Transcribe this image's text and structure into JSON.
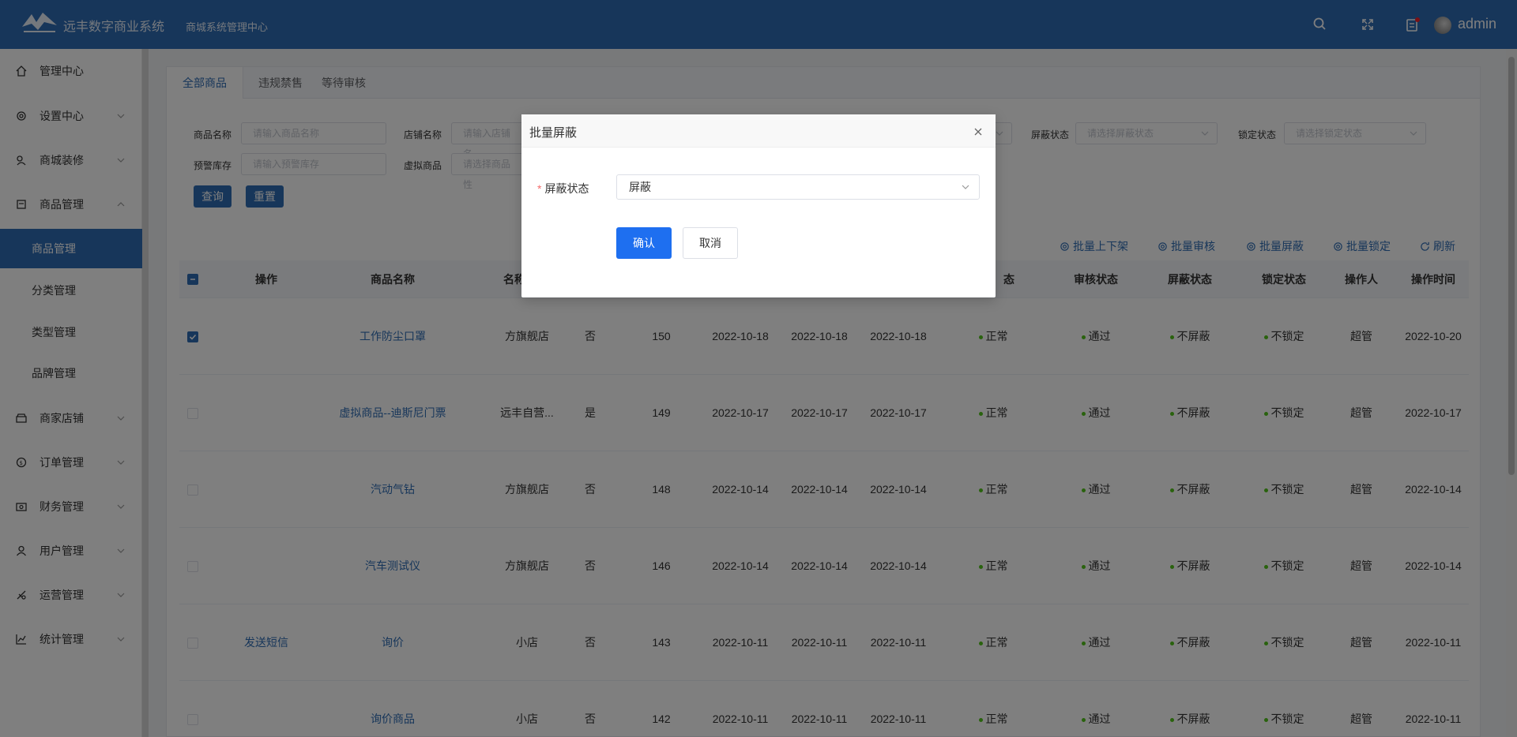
{
  "header": {
    "app_title": "远丰数字商业系统",
    "sub_title": "商城系统管理中心",
    "user": "admin"
  },
  "sidebar": {
    "items": [
      {
        "label": "管理中心",
        "icon": "home-icon"
      },
      {
        "label": "设置中心",
        "icon": "gear-icon"
      },
      {
        "label": "商城装修",
        "icon": "decoration-icon"
      },
      {
        "label": "商品管理",
        "icon": "goods-icon"
      },
      {
        "label": "商家店铺",
        "icon": "shop-icon"
      },
      {
        "label": "订单管理",
        "icon": "order-icon"
      },
      {
        "label": "财务管理",
        "icon": "finance-icon"
      },
      {
        "label": "用户管理",
        "icon": "user-icon"
      },
      {
        "label": "运营管理",
        "icon": "operation-icon"
      },
      {
        "label": "统计管理",
        "icon": "chart-icon"
      }
    ],
    "sub_items": [
      "商品管理",
      "分类管理",
      "类型管理",
      "品牌管理"
    ]
  },
  "tabs": [
    "全部商品",
    "违规禁售",
    "等待审核"
  ],
  "filters": {
    "goods_name": {
      "label": "商品名称",
      "placeholder": "请输入商品名称"
    },
    "store_name": {
      "label": "店铺名称",
      "placeholder": "请输入店铺名"
    },
    "shield_status": {
      "label": "屏蔽状态",
      "placeholder": "请选择屏蔽状态"
    },
    "lock_status": {
      "label": "锁定状态",
      "placeholder": "请选择锁定状态"
    },
    "warning_stock": {
      "label": "预警库存",
      "placeholder": "请输入预警库存"
    },
    "virtual_goods": {
      "label": "虚拟商品",
      "placeholder": "请选择商品性"
    },
    "query_label": "查询",
    "reset_label": "重置"
  },
  "toolbar": {
    "batch_shelf": "批量上下架",
    "batch_audit": "批量审核",
    "batch_shield": "批量屏蔽",
    "batch_lock": "批量锁定",
    "refresh": "刷新"
  },
  "table": {
    "headers": {
      "op": "操作",
      "goods_name": "商品名称",
      "store_name": "名称",
      "status": "态",
      "audit": "审核状态",
      "shield": "屏蔽状态",
      "lock": "锁定状态",
      "operator": "操作人",
      "op_time": "操作时间"
    },
    "rows": [
      {
        "checked": true,
        "op": "",
        "name": "工作防尘口罩",
        "store": "方旗舰店",
        "virtual": "否",
        "id": "150",
        "d1": "2022-10-18",
        "d2": "2022-10-18",
        "d3": "2022-10-18",
        "status": "正常",
        "audit": "通过",
        "shield": "不屏蔽",
        "lock": "不锁定",
        "operator": "超管",
        "time": "2022-10-20"
      },
      {
        "checked": false,
        "op": "",
        "name": "虚拟商品--迪斯尼门票",
        "store": "远丰自营...",
        "virtual": "是",
        "id": "149",
        "d1": "2022-10-17",
        "d2": "2022-10-17",
        "d3": "2022-10-17",
        "status": "正常",
        "audit": "通过",
        "shield": "不屏蔽",
        "lock": "不锁定",
        "operator": "超管",
        "time": "2022-10-17"
      },
      {
        "checked": false,
        "op": "",
        "name": "汽动气钻",
        "store": "方旗舰店",
        "virtual": "否",
        "id": "148",
        "d1": "2022-10-14",
        "d2": "2022-10-14",
        "d3": "2022-10-14",
        "status": "正常",
        "audit": "通过",
        "shield": "不屏蔽",
        "lock": "不锁定",
        "operator": "超管",
        "time": "2022-10-14"
      },
      {
        "checked": false,
        "op": "",
        "name": "汽车测试仪",
        "store": "方旗舰店",
        "virtual": "否",
        "id": "146",
        "d1": "2022-10-14",
        "d2": "2022-10-14",
        "d3": "2022-10-14",
        "status": "正常",
        "audit": "通过",
        "shield": "不屏蔽",
        "lock": "不锁定",
        "operator": "超管",
        "time": "2022-10-14"
      },
      {
        "checked": false,
        "op": "发送短信",
        "name": "询价",
        "store": "小店",
        "virtual": "否",
        "id": "143",
        "d1": "2022-10-11",
        "d2": "2022-10-11",
        "d3": "2022-10-11",
        "status": "正常",
        "audit": "通过",
        "shield": "不屏蔽",
        "lock": "不锁定",
        "operator": "超管",
        "time": "2022-10-11"
      },
      {
        "checked": false,
        "op": "",
        "name": "询价商品",
        "store": "小店",
        "virtual": "否",
        "id": "142",
        "d1": "2022-10-11",
        "d2": "2022-10-11",
        "d3": "2022-10-11",
        "status": "正常",
        "audit": "通过",
        "shield": "不屏蔽",
        "lock": "不锁定",
        "operator": "超管",
        "time": "2022-10-11"
      }
    ]
  },
  "modal": {
    "title": "批量屏蔽",
    "field_label": "屏蔽状态",
    "field_value": "屏蔽",
    "ok_label": "确认",
    "cancel_label": "取消"
  },
  "colors": {
    "primary": "#2f6db5",
    "confirm": "#1e6ff0",
    "status_dot": "#52c41a"
  }
}
